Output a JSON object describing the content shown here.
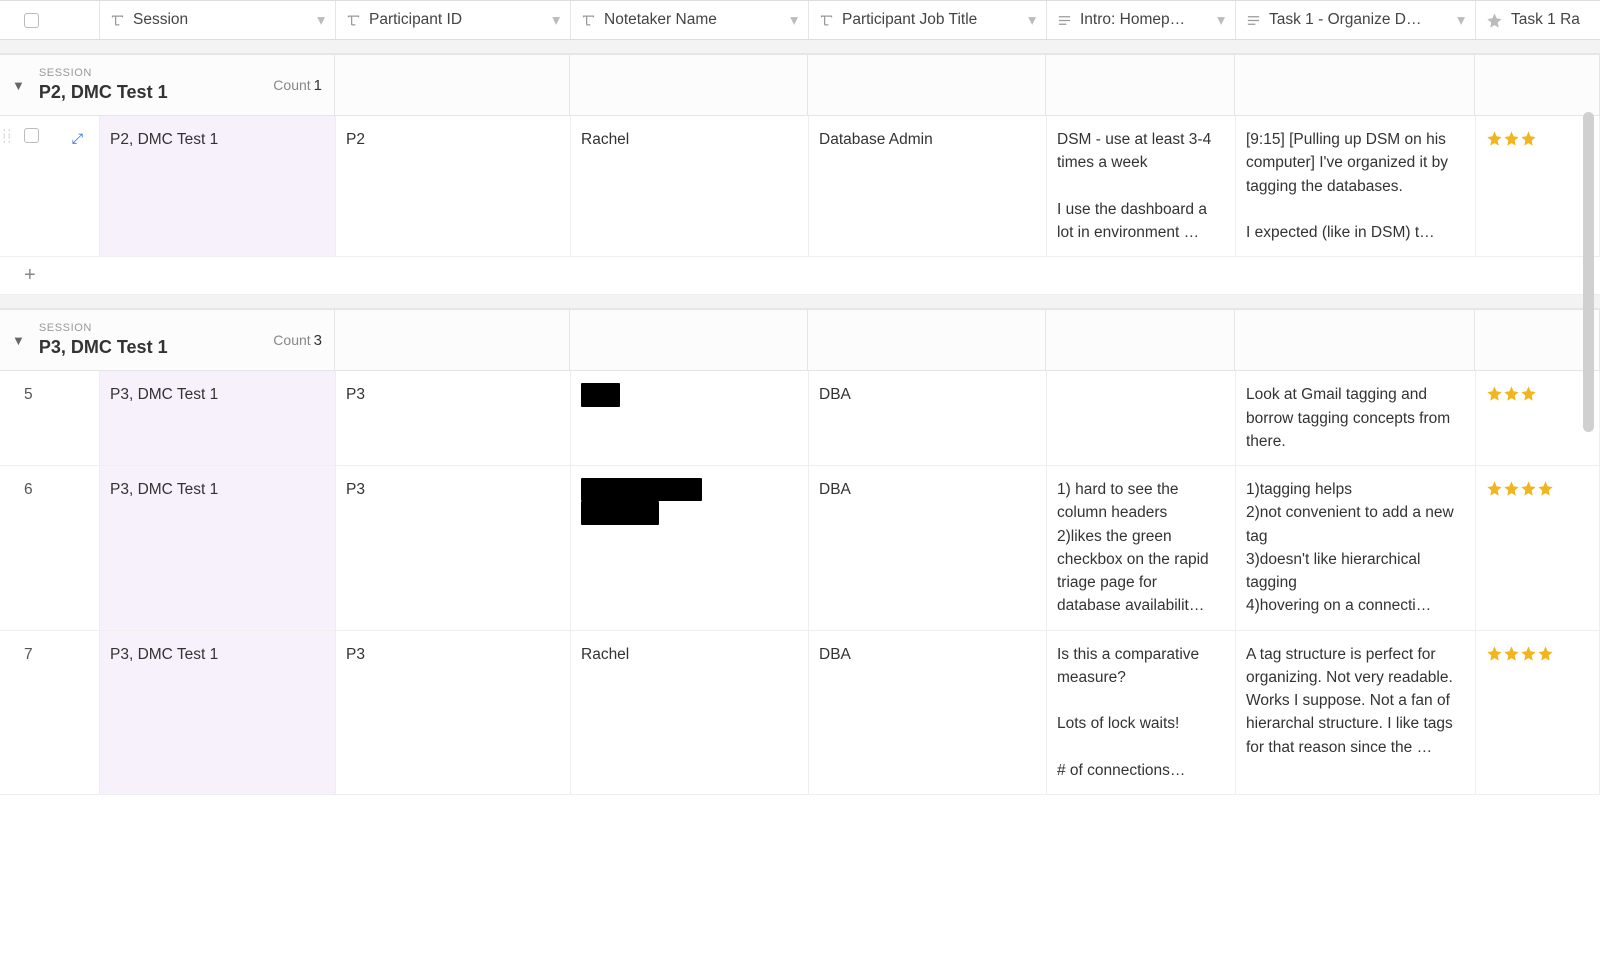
{
  "columns": {
    "session": "Session",
    "participant_id": "Participant ID",
    "notetaker": "Notetaker Name",
    "job_title": "Participant Job Title",
    "intro": "Intro: Homep…",
    "task1": "Task 1 - Organize D…",
    "task1_rating": "Task 1 Ra"
  },
  "group_key_label": "SESSION",
  "count_label": "Count",
  "groups": [
    {
      "value": "P2, DMC Test 1",
      "count": "1",
      "rows": [
        {
          "row_num": "",
          "session": "P2, DMC Test 1",
          "participant_id": "P2",
          "notetaker": "Rachel",
          "job_title": "Database Admin",
          "intro": "DSM - use at least 3-4 times a week\n\nI use the dashboard a lot in environment …",
          "task1": "[9:15] [Pulling up DSM on his computer] I've organized it by tagging the databases.\n\nI expected (like in DSM) t…",
          "rating": 3,
          "highlighted": true
        }
      ]
    },
    {
      "value": "P3, DMC Test 1",
      "count": "3",
      "rows": [
        {
          "row_num": "5",
          "session": "P3, DMC Test 1",
          "participant_id": "P3",
          "notetaker_redacted": [
            "xxxxx"
          ],
          "job_title": "DBA",
          "intro": "",
          "task1": "Look at Gmail tagging and borrow tagging concepts from there.",
          "rating": 3
        },
        {
          "row_num": "6",
          "session": "P3, DMC Test 1",
          "participant_id": "P3",
          "notetaker_redacted": [
            "xxxxxxx xxxxxxxx",
            "xxxxxxxxxx"
          ],
          "job_title": "DBA",
          "intro": "1) hard to see the column headers\n2)likes the green checkbox on the rapid triage page for database availabilit…",
          "task1": "1)tagging helps\n2)not convenient to add a new tag\n3)doesn't like hierarchical tagging\n4)hovering on a connecti…",
          "rating": 4
        },
        {
          "row_num": "7",
          "session": "P3, DMC Test 1",
          "participant_id": "P3",
          "notetaker": "Rachel",
          "job_title": "DBA",
          "intro": "Is this a comparative measure?\n\nLots of lock waits!\n\n# of connections…",
          "task1": "A tag structure is perfect for organizing. Not very readable. Works I suppose. Not a fan of hierarchal structure. I like tags for that reason since the …",
          "rating": 4
        }
      ]
    }
  ]
}
